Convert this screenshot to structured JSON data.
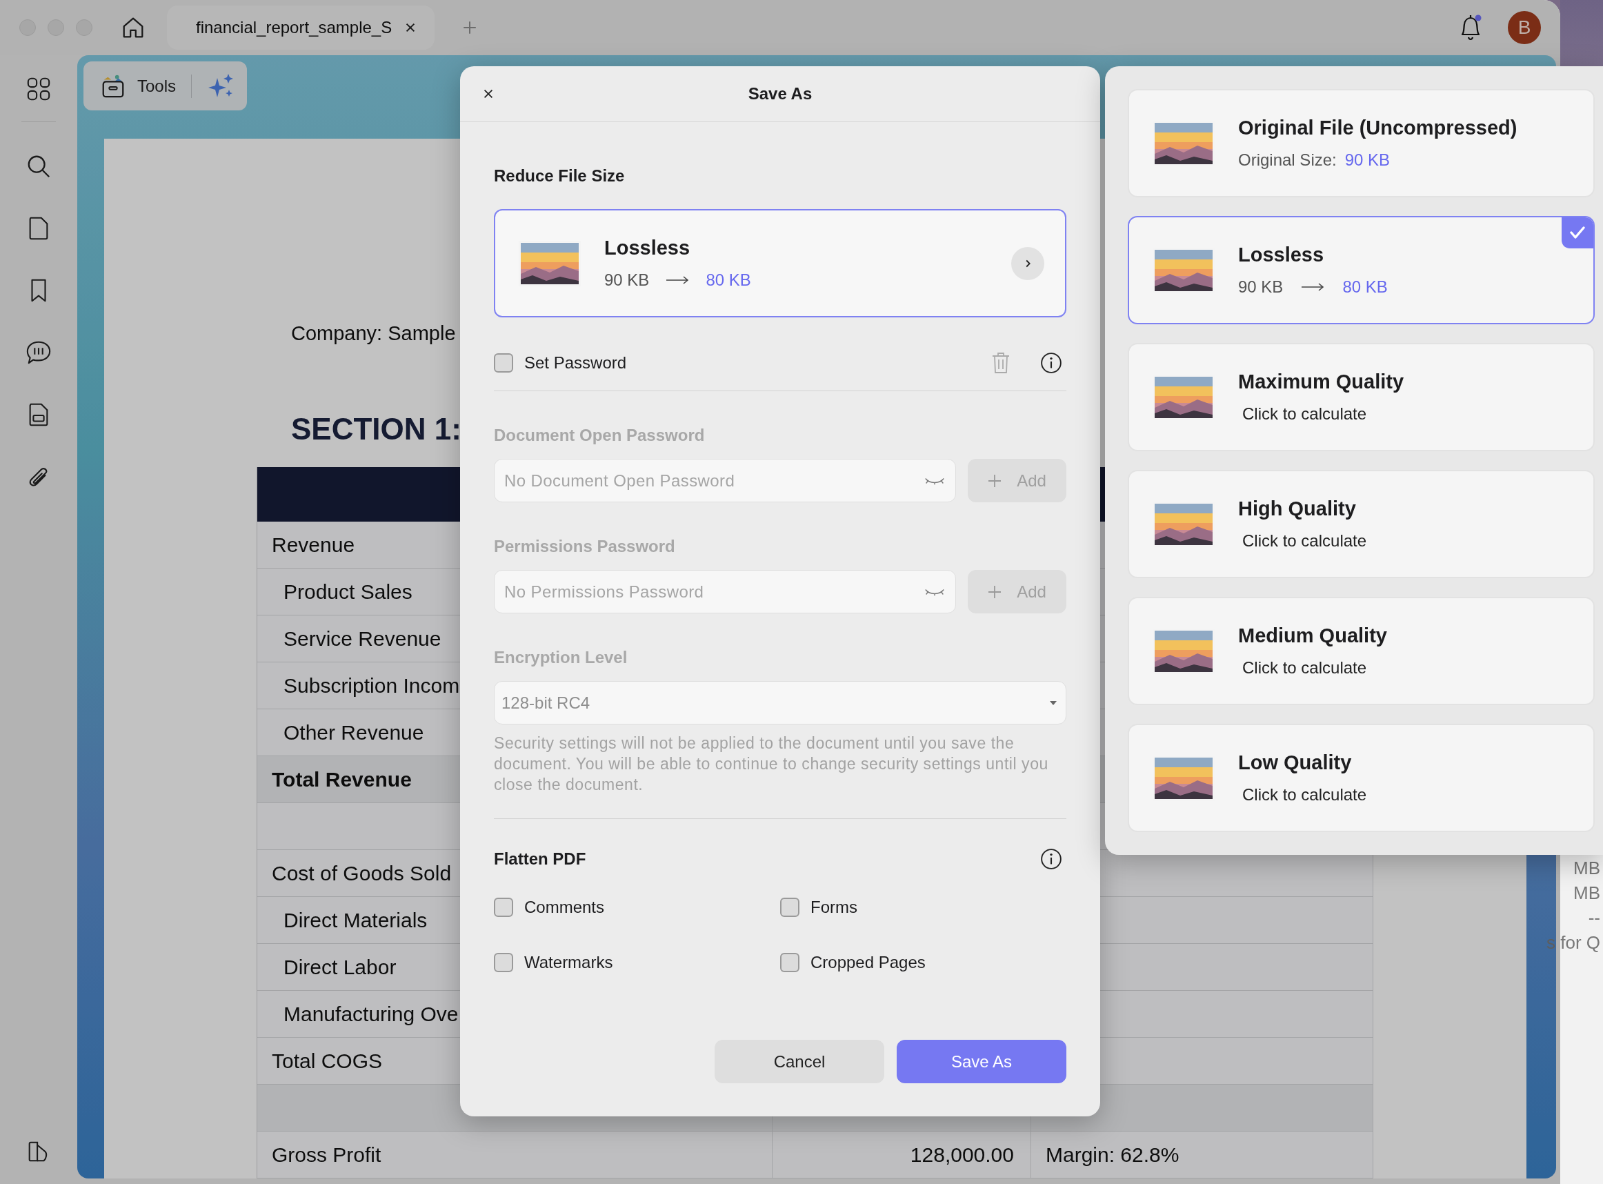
{
  "title_bar": {
    "tab": {
      "title": "financial_report_sample_S"
    },
    "notifications": {
      "unread": true
    },
    "avatar": {
      "initial": "B"
    }
  },
  "toolbar": {
    "tools_label": "Tools"
  },
  "document": {
    "company": "Company: Sample",
    "section": "SECTION 1:",
    "rows": [
      {
        "kind": "section",
        "shaded": false,
        "cells": [
          "Revenue"
        ]
      },
      {
        "kind": "item",
        "shaded": false,
        "cells": [
          "Product Sales"
        ]
      },
      {
        "kind": "item",
        "shaded": false,
        "cells": [
          "Service Revenue"
        ]
      },
      {
        "kind": "item",
        "shaded": false,
        "cells": [
          "Subscription Incom"
        ]
      },
      {
        "kind": "item",
        "shaded": false,
        "cells": [
          "Other Revenue"
        ]
      },
      {
        "kind": "total",
        "shaded": true,
        "cells": [
          "Total Revenue"
        ]
      },
      {
        "kind": "spacer",
        "shaded": false,
        "cells": []
      },
      {
        "kind": "section",
        "shaded": false,
        "cells": [
          "Cost of Goods Sold"
        ]
      },
      {
        "kind": "item",
        "shaded": false,
        "cells": [
          "Direct Materials"
        ]
      },
      {
        "kind": "item",
        "shaded": false,
        "cells": [
          "Direct Labor"
        ]
      },
      {
        "kind": "item",
        "shaded": false,
        "cells": [
          "Manufacturing Ove"
        ]
      },
      {
        "kind": "section",
        "shaded": false,
        "cells": [
          "Total COGS"
        ]
      },
      {
        "kind": "spacer",
        "shaded": true,
        "cells": []
      },
      {
        "kind": "section",
        "shaded": false,
        "cells": [
          "Gross Profit",
          "128,000.00",
          "Margin: 62.8%"
        ]
      }
    ]
  },
  "dialog": {
    "title": "Save As",
    "reduce_label": "Reduce File Size",
    "compression": {
      "title": "Lossless",
      "from": "90 KB",
      "to": "80 KB"
    },
    "set_password": {
      "label": "Set Password",
      "checked": false
    },
    "open_password": {
      "label": "Document Open Password",
      "placeholder": "No Document Open Password",
      "button": "Add",
      "disabled": true
    },
    "permissions_password": {
      "label": "Permissions Password",
      "placeholder": "No Permissions Password",
      "button": "Add",
      "disabled": true
    },
    "encryption": {
      "label": "Encryption Level",
      "value": "128-bit RC4",
      "disabled": true
    },
    "note": "Security settings will not be applied to the document until you save the document. You will be able to continue to change security settings until you close the document.",
    "flatten": {
      "label": "Flatten PDF",
      "options": [
        {
          "label": "Comments",
          "checked": false
        },
        {
          "label": "Forms",
          "checked": false
        },
        {
          "label": "Watermarks",
          "checked": false
        },
        {
          "label": "Cropped Pages",
          "checked": false
        }
      ]
    },
    "buttons": [
      {
        "label": "Cancel",
        "kind": "secondary"
      },
      {
        "label": "Save As",
        "kind": "primary"
      }
    ]
  },
  "compression_options": [
    {
      "kind": "original",
      "title": "Original File (Uncompressed)",
      "label": "Original Size:",
      "value": "90 KB",
      "selected": false
    },
    {
      "kind": "estimate",
      "title": "Lossless",
      "from": "90 KB",
      "to": "80 KB",
      "selected": true
    },
    {
      "kind": "pending",
      "title": "Maximum Quality",
      "detail": "Click to calculate",
      "selected": false
    },
    {
      "kind": "pending",
      "title": "High Quality",
      "detail": "Click to calculate",
      "selected": false
    },
    {
      "kind": "pending",
      "title": "Medium Quality",
      "detail": "Click to calculate",
      "selected": false
    },
    {
      "kind": "pending",
      "title": "Low Quality",
      "detail": "Click to calculate",
      "selected": false
    }
  ],
  "background_window": {
    "texts": [
      "MB",
      "MB",
      "--",
      "s for Q"
    ]
  }
}
